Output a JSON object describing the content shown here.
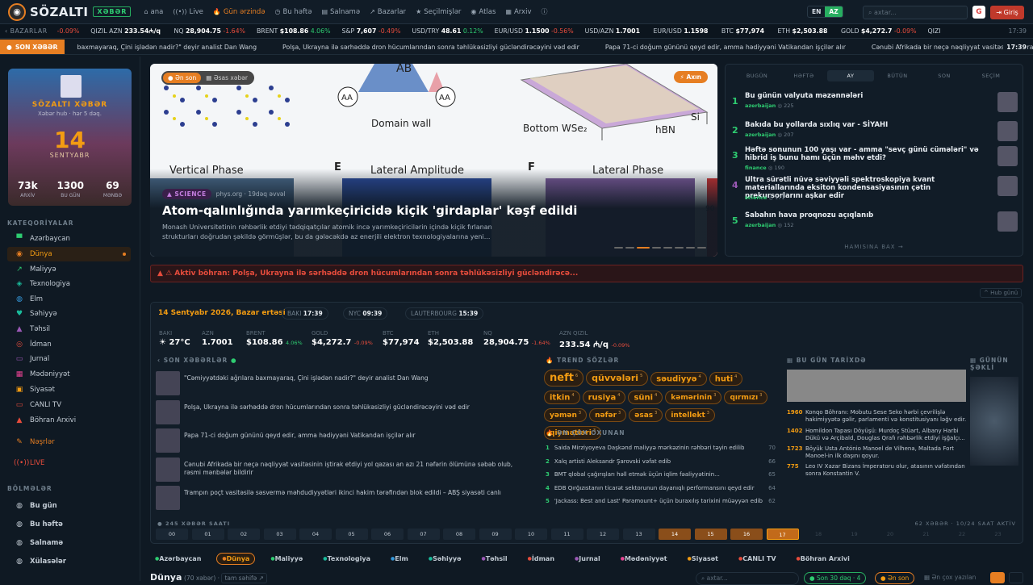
{
  "header": {
    "logo_text": "SÖZALTI",
    "logo_badge": "XƏBƏR",
    "nav": [
      {
        "icon": "⌂",
        "label": "ana"
      },
      {
        "icon": "((•))",
        "label": "Live"
      },
      {
        "icon": "🔥",
        "label": "Gün ərzində"
      },
      {
        "icon": "◷",
        "label": "Bu həftə"
      },
      {
        "icon": "▤",
        "label": "Salnamə"
      },
      {
        "icon": "↗",
        "label": "Bazarlar"
      },
      {
        "icon": "★",
        "label": "Seçilmişlər"
      },
      {
        "icon": "◉",
        "label": "Atlas"
      },
      {
        "icon": "▦",
        "label": "Arxiv"
      },
      {
        "icon": "ⓘ",
        "label": ""
      }
    ],
    "lang_en": "EN",
    "lang_az": "AZ",
    "search_placeholder": "axtar...",
    "google": "G",
    "login": "Giriş"
  },
  "ticker": {
    "label": "BAZARLAR",
    "first_change": "-0.09%",
    "items": [
      {
        "name": "QIZIL AZN",
        "value": "233.54₼/q",
        "change": "",
        "dir": "up"
      },
      {
        "name": "NQ",
        "value": "28,904.75",
        "change": "-1.64%",
        "dir": "dn"
      },
      {
        "name": "BRENT",
        "value": "$108.86",
        "change": "4.06%",
        "dir": "up"
      },
      {
        "name": "S&P",
        "value": "7,607",
        "change": "-0.49%",
        "dir": "dn"
      },
      {
        "name": "USD/TRY",
        "value": "48.61",
        "change": "0.12%",
        "dir": "up"
      },
      {
        "name": "EUR/USD",
        "value": "1.1500",
        "change": "-0.56%",
        "dir": "dn"
      },
      {
        "name": "USD/AZN",
        "value": "1.7001",
        "change": "",
        "dir": ""
      },
      {
        "name": "EUR/USD",
        "value": "1.1598",
        "change": "",
        "dir": ""
      },
      {
        "name": "BTC",
        "value": "$77,974",
        "change": "",
        "dir": ""
      },
      {
        "name": "ETH",
        "value": "$2,503.88",
        "change": "",
        "dir": ""
      },
      {
        "name": "GOLD",
        "value": "$4,272.7",
        "change": "-0.09%",
        "dir": "dn"
      },
      {
        "name": "QIZI",
        "value": "",
        "change": "",
        "dir": ""
      }
    ],
    "time": "17:39"
  },
  "breaking": {
    "label": "SON XƏBƏR",
    "items": [
      "baxmayaraq, Çini işlədən nadir?\" deyir analist Dan Wang",
      "Polşa, Ukrayna ilə sərhəddə dron hücumlarından sonra təhlükəsizliyi gücləndirəcəyini vəd edir",
      "Papa 71-ci doğum gününü qeyd edir, amma hədiyyəni Vatikandan işçilər alır",
      "Cənubi Afrikada bir neçə nəqliyyat vasitəsinin iştirak etdiyi"
    ],
    "time": "17:39"
  },
  "sidebar": {
    "date_title": "SÖZALTI XƏBƏR",
    "date_sub": "Xəbər hub · hər 5 dəq.",
    "day": "14",
    "month": "SENTYABR",
    "stats": [
      {
        "value": "73k",
        "label": "ARXİV"
      },
      {
        "value": "1300",
        "label": "BU GÜN"
      },
      {
        "value": "69",
        "label": "MƏNBƏ"
      }
    ],
    "cat_header": "KATEQORİYALAR",
    "categories": [
      {
        "icon": "▀",
        "label": "Azərbaycan",
        "color": "#2ecc71"
      },
      {
        "icon": "◉",
        "label": "Dünya",
        "color": "#e67e22"
      },
      {
        "icon": "↗",
        "label": "Maliyyə",
        "color": "#2ecc71"
      },
      {
        "icon": "◈",
        "label": "Texnologiya",
        "color": "#1abc9c"
      },
      {
        "icon": "◍",
        "label": "Elm",
        "color": "#3498db"
      },
      {
        "icon": "♥",
        "label": "Səhiyyə",
        "color": "#1abc9c"
      },
      {
        "icon": "▲",
        "label": "Təhsil",
        "color": "#9b59b6"
      },
      {
        "icon": "◎",
        "label": "İdman",
        "color": "#e74c3c"
      },
      {
        "icon": "▭",
        "label": "Jurnal",
        "color": "#9b59b6"
      },
      {
        "icon": "▦",
        "label": "Mədəniyyət",
        "color": "#e84393"
      },
      {
        "icon": "▣",
        "label": "Siyasət",
        "color": "#f39c12"
      },
      {
        "icon": "▭",
        "label": "CANLI TV",
        "color": "#e74c3c"
      },
      {
        "icon": "▲",
        "label": "Böhran Arxivi",
        "color": "#e74c3c"
      }
    ],
    "extra": [
      {
        "icon": "✎",
        "label": "Nəşrlər",
        "color": "#e67e22"
      },
      {
        "icon": "((•))",
        "label": "LIVE",
        "color": "#e74c3c"
      }
    ],
    "sections_header": "BÖLMƏLƏR",
    "sections": [
      "Bu gün",
      "Bu həftə",
      "Salnamə",
      "Xülasələr"
    ]
  },
  "hero": {
    "tab_latest": "Ən son",
    "tab_main": "Əsas xəbər",
    "flow": "Axın",
    "category": "SCIENCE",
    "meta": "phys.org · 19dəq əvvəl",
    "title": "Atom-qalınlığında yarımkeçiricidə kiçik 'girdaplar' kəşf edildi",
    "desc": "Monash Universitetinin rəhbərlik etdiyi tədqiqatçılar atomik incə yarımkeçiricilərin içində kiçik fırlanan strukturları doğrudan şəkildə görmüşlər, bu da gələcəkdə az enerjili elektron texnologiyalarına yeni...",
    "figure_labels": [
      "AB",
      "AA",
      "AA",
      "Domain wall",
      "Bottom WSe₂",
      "hBN",
      "Si",
      "Vertical Phase",
      "E",
      "Lateral Amplitude",
      "F",
      "Lateral Phase",
      "90"
    ]
  },
  "ranking": {
    "tabs": [
      "BUGÜN",
      "HƏFTƏ",
      "AY",
      "BÜTÜN",
      "SON",
      "SEÇİM"
    ],
    "items": [
      {
        "n": "1",
        "title": "Bu günün valyuta məzənnələri",
        "cat": "azerbaijan",
        "views": "225"
      },
      {
        "n": "2",
        "title": "Bakıda bu yollarda sıxlıq var - SİYAHI",
        "cat": "azerbaijan",
        "views": "207"
      },
      {
        "n": "3",
        "title": "Həftə sonunun 100 yaşı var - amma \"sevç günü cümələri\" və hibrid iş bunu hamı üçün məhv etdi?",
        "cat": "finance",
        "views": "190"
      },
      {
        "n": "4",
        "title": "Ultra sürətli nüvə səviyyəli spektroskopiya kvant materiallarında eksiton kondensasiyasının çətin prekursorlarını aşkar edir",
        "cat": "science",
        "views": "171"
      },
      {
        "n": "5",
        "title": "Sabahın hava proqnozu açıqlanıb",
        "cat": "azerbaijan",
        "views": "152"
      }
    ],
    "more": "HAMISINA BAX →"
  },
  "alert": "⚠ Aktiv böhran: Polşa, Ukrayna ilə sərhəddə dron hücumlarından sonra təhlükəsizliyi gücləndirəcə...",
  "hub_link": "Hub günü",
  "dashboard": {
    "date": "14 Sentyabr 2026, Bazar ertəsi",
    "clocks": [
      {
        "city": "BAKI",
        "time": "17:39"
      },
      {
        "city": "NYC",
        "time": "09:39"
      },
      {
        "city": "LAUTERBOURG",
        "time": "15:39"
      }
    ],
    "markets": [
      {
        "label": "BAKI",
        "value": "☀ 27°C",
        "change": "",
        "dir": ""
      },
      {
        "label": "AZN",
        "value": "1.7001",
        "change": "",
        "dir": ""
      },
      {
        "label": "BRENT",
        "value": "$108.86",
        "change": "4.06%",
        "dir": "up"
      },
      {
        "label": "GOLD",
        "value": "$4,272.7",
        "change": "-0.09%",
        "dir": "dn"
      },
      {
        "label": "BTC",
        "value": "$77,974",
        "change": "",
        "dir": ""
      },
      {
        "label": "ETH",
        "value": "$2,503.88",
        "change": "",
        "dir": ""
      },
      {
        "label": "NQ",
        "value": "28,904.75",
        "change": "-1.64%",
        "dir": "dn"
      },
      {
        "label": "AZN QIZIL",
        "value": "233.54 ₼/q",
        "change": "-0.09%",
        "dir": "dn"
      }
    ],
    "latest_header": "SON XƏBƏRLƏR",
    "latest": [
      "\"Cəmiyyətdəki ağrılara baxmayaraq, Çini işlədən nadir?\" deyir analist Dan Wang",
      "Polşa, Ukrayna ilə sərhəddə dron hücumlarından sonra təhlükəsizliyi gücləndirəcəyini vəd edir",
      "Papa 71-ci doğum gününü qeyd edir, amma hədiyyəni Vatikandan işçilər alır",
      "Cənubi Afrikada bir neçə nəqliyyat vasitəsinin iştirak etdiyi yol qəzası an azı 21 nəfərin ölümünə səbəb olub, rəsmi mənbələr bildirir",
      "Trampın poçt vasitəsilə səsvermə məhdudiyyətləri ikinci hakim tərəfindən blok edildi – ABŞ siyasəti canlı"
    ],
    "trend_header": "TREND SÖZLƏR",
    "trends": [
      {
        "w": "neft",
        "c": "6",
        "s": "13px"
      },
      {
        "w": "qüvvələri",
        "c": "5",
        "s": "11px"
      },
      {
        "w": "səudiyyə",
        "c": "4",
        "s": "10px"
      },
      {
        "w": "huti",
        "c": "4",
        "s": "10px"
      },
      {
        "w": "itkin",
        "c": "4",
        "s": "10px"
      },
      {
        "w": "rusiya",
        "c": "4",
        "s": "10px"
      },
      {
        "w": "süni",
        "c": "4",
        "s": "10px"
      },
      {
        "w": "kəmərinin",
        "c": "3",
        "s": "9px"
      },
      {
        "w": "qırmızı",
        "c": "3",
        "s": "9px"
      },
      {
        "w": "yəmən",
        "c": "3",
        "s": "9px"
      },
      {
        "w": "nəfər",
        "c": "3",
        "s": "9px"
      },
      {
        "w": "əsas",
        "c": "3",
        "s": "9px"
      },
      {
        "w": "intellekt",
        "c": "3",
        "s": "9px"
      },
      {
        "w": "qiymətləri",
        "c": "3",
        "s": "9px"
      }
    ],
    "read_header": "ƏN ÇOX OXUNAN",
    "most_read": [
      {
        "n": "1",
        "t": "Saida Mirziyoyeva Daşkənd maliyyə mərkəzinin rəhbəri təyin edilib",
        "v": "70"
      },
      {
        "n": "2",
        "t": "Xalq artisti Aleksandr Şarovski vəfat edib",
        "v": "66"
      },
      {
        "n": "3",
        "t": "BMT qlobal çağırışları həll etmək üçün iqlim fəaliyyətinin...",
        "v": "65"
      },
      {
        "n": "4",
        "t": "EDB Qırğızıstanın ticarət sektorunun dayanıqlı performansını qeyd edir",
        "v": "64"
      },
      {
        "n": "5",
        "t": "'Jackass: Best and Last' Paramount+ üçün buraxılış tarixini müəyyən edib",
        "v": "62"
      }
    ],
    "history_header": "BU GÜN TARİXDƏ",
    "history": [
      {
        "y": "1960",
        "t": "Konqo Böhranı: Mobutu Sese Seko hərbi çevrilişlə hakimiyyətə gəlir, parlamenti və konstitusiyanı ləğv edir."
      },
      {
        "y": "1402",
        "t": "Homildon Tapası Döyüşü: Murdoç Stüart, Albany Harbi Dükü və Arçibald, Douglas Qrafı rəhbərlik etdiyi işğalçı..."
      },
      {
        "y": "1723",
        "t": "Böyük Usta António Manoel de Vilhena, Maltada Fort Manoel-in ilk daşını qoyur."
      },
      {
        "y": "775",
        "t": "Leo IV Xazar Bizans İmperatoru olur, atasının vəfatından sonra Konstantin V."
      }
    ],
    "photo_header": "GÜNÜN ŞƏKLİ",
    "hours_header": "245 XƏBƏR SAATI",
    "hours_right": "62 XƏBƏR · 10/24 SAAT AKTİV",
    "hours": [
      "00",
      "01",
      "02",
      "03",
      "04",
      "05",
      "06",
      "07",
      "08",
      "09",
      "10",
      "11",
      "12",
      "13",
      "14",
      "15",
      "16",
      "17",
      "18",
      "19",
      "20",
      "21",
      "22",
      "23"
    ]
  },
  "catbar": [
    "Azərbaycan",
    "Dünya",
    "Maliyyə",
    "Texnologiya",
    "Elm",
    "Səhiyyə",
    "Təhsil",
    "İdman",
    "Jurnal",
    "Mədəniyyət",
    "Siyasət",
    "CANLI TV",
    "Böhran Arxivi"
  ],
  "bottom": {
    "title": "Dünya",
    "count": "(70 xəbər)",
    "full": "tam səhifə ↗",
    "search": "axtar...",
    "last30": "Son 30 dəq · 4",
    "latest": "Ən son",
    "most_read": "Ən çox yazılan"
  },
  "colors": {
    "accent": "#e67e22",
    "green": "#2ecc71",
    "red": "#e74c3c",
    "bg": "#0f1923"
  }
}
